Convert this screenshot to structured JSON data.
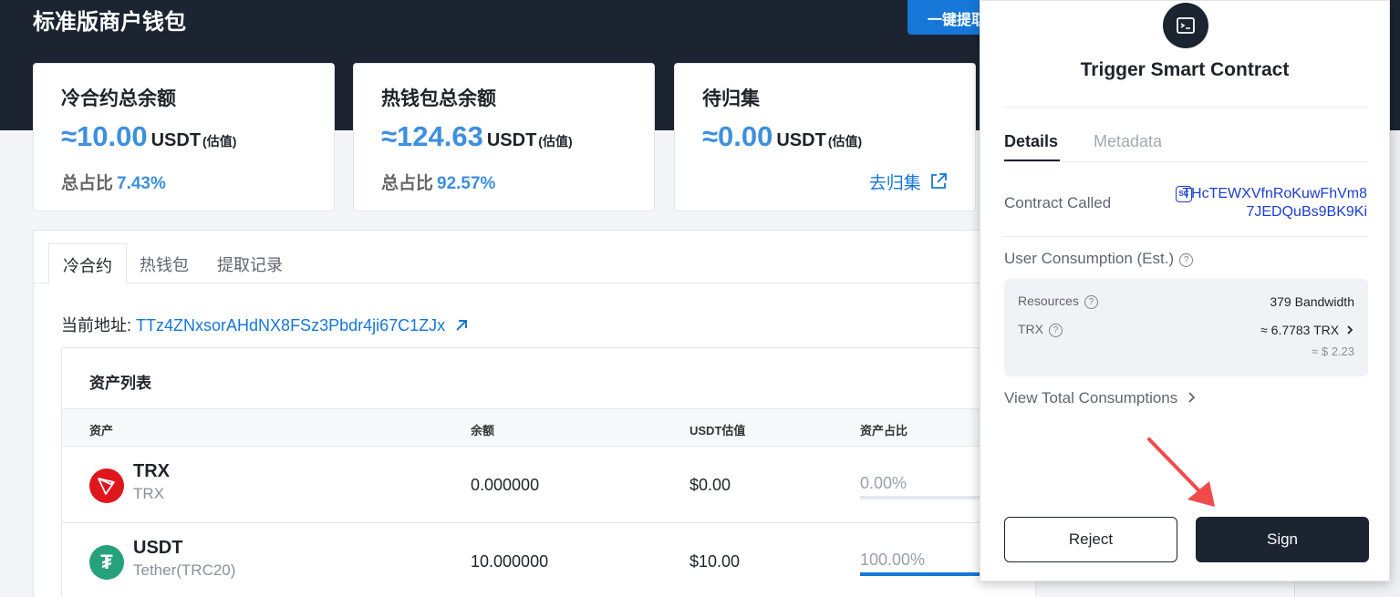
{
  "app": {
    "title": "标准版商户钱包",
    "withdraw_button": "一键提取"
  },
  "summary_cards": [
    {
      "title": "冷合约总余额",
      "value": "≈10.00",
      "unit": "USDT",
      "est": "(估值)",
      "ratio_label": "总占比",
      "ratio": "7.43%"
    },
    {
      "title": "热钱包总余额",
      "value": "≈124.63",
      "unit": "USDT",
      "est": "(估值)",
      "ratio_label": "总占比",
      "ratio": "92.57%"
    },
    {
      "title": "待归集",
      "value": "≈0.00",
      "unit": "USDT",
      "est": "(估值)",
      "link": "去归集"
    }
  ],
  "tabs": [
    "冷合约",
    "热钱包",
    "提取记录"
  ],
  "address": {
    "label": "当前地址:",
    "value": "TTz4ZNxsorAHdNX8FSz3Pbdr4ji67C1ZJx"
  },
  "asset_list": {
    "title": "资产列表",
    "columns": [
      "资产",
      "余额",
      "USDT估值",
      "资产占比"
    ],
    "rows": [
      {
        "symbol": "TRX",
        "name": "TRX",
        "balance": "0.000000",
        "usdt_value": "$0.00",
        "share": "0.00%",
        "share_fraction": 0.0,
        "color": "#e0161d"
      },
      {
        "symbol": "USDT",
        "name": "Tether(TRC20)",
        "balance": "10.000000",
        "usdt_value": "$10.00",
        "share": "100.00%",
        "share_fraction": 1.0,
        "color": "#26a17b"
      }
    ]
  },
  "popup": {
    "title": "Trigger Smart Contract",
    "tabs": [
      "Details",
      "Metadata"
    ],
    "contract_called_label": "Contract Called",
    "contract_badge": "SC",
    "contract_address": "THcTEWXVfnRoKuwFhVm87JEDQuBs9BK9Ki",
    "user_consumption_label": "User Consumption (Est.)",
    "resources_label": "Resources",
    "resources_value": "379 Bandwidth",
    "trx_label": "TRX",
    "trx_value": "≈ 6.7783 TRX",
    "usd_value": "≈ $ 2.23",
    "view_total": "View Total Consumptions",
    "reject_button": "Reject",
    "sign_button": "Sign"
  }
}
